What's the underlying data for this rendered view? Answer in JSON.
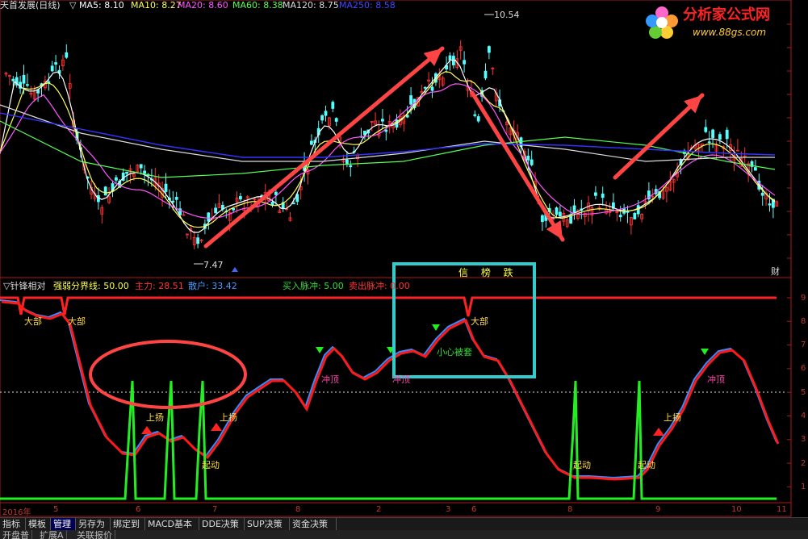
{
  "header": {
    "title": "天首发展(日线)",
    "ma": [
      {
        "label": "MA5: 8.10",
        "color": "#ffffff"
      },
      {
        "label": "MA10: 8.27",
        "color": "#ffff55"
      },
      {
        "label": "MA20: 8.60",
        "color": "#ff55ff"
      },
      {
        "label": "MA60: 8.38",
        "color": "#55ff55"
      },
      {
        "label": "MA120: 8.75",
        "color": "#dddddd"
      },
      {
        "label": "MA250: 8.58",
        "color": "#4444ff"
      }
    ]
  },
  "price_annotations": {
    "high": "10.54",
    "low": "7.47"
  },
  "logo": {
    "main": "分析家公式网",
    "sub": "www.88gs.com"
  },
  "indicator": {
    "name": "▽针锋相对",
    "threshold": "强弱分界线: 50.00",
    "main_force": "主力: 28.51",
    "retail": "散户: 33.42",
    "buy_pulse": "买入脉冲: 5.00",
    "sell_pulse": "卖出脉冲: 0.00",
    "box_text": "信 榜 跌",
    "box_note": "小心被套"
  },
  "labels": {
    "dabu": "大部",
    "shangyang": "上扬",
    "chongding": "冲顶",
    "qidong": "起动",
    "cai": "财"
  },
  "right_axis": [
    "9",
    "8",
    "7",
    "6",
    "5",
    "4",
    "3",
    "2",
    "1"
  ],
  "date_axis": [
    "2016年",
    "5",
    "6",
    "7",
    "8",
    "2",
    "3",
    "6",
    "8",
    "9",
    "10",
    "11"
  ],
  "toolbar": {
    "tabs": [
      "指标",
      "模板",
      "管理",
      "另存为",
      "绑定到",
      "MACD基本",
      "DDE决策",
      "SUP决策",
      "资金决策"
    ],
    "active": "管理",
    "tabs2": [
      "开盘普",
      "扩展A",
      "关联报价"
    ]
  },
  "colors": {
    "background": "#000000",
    "red_line": "#ff1a1a",
    "blue_line": "#3b8cff",
    "green_pulse": "#22ee22",
    "box": "#33cccc"
  }
}
